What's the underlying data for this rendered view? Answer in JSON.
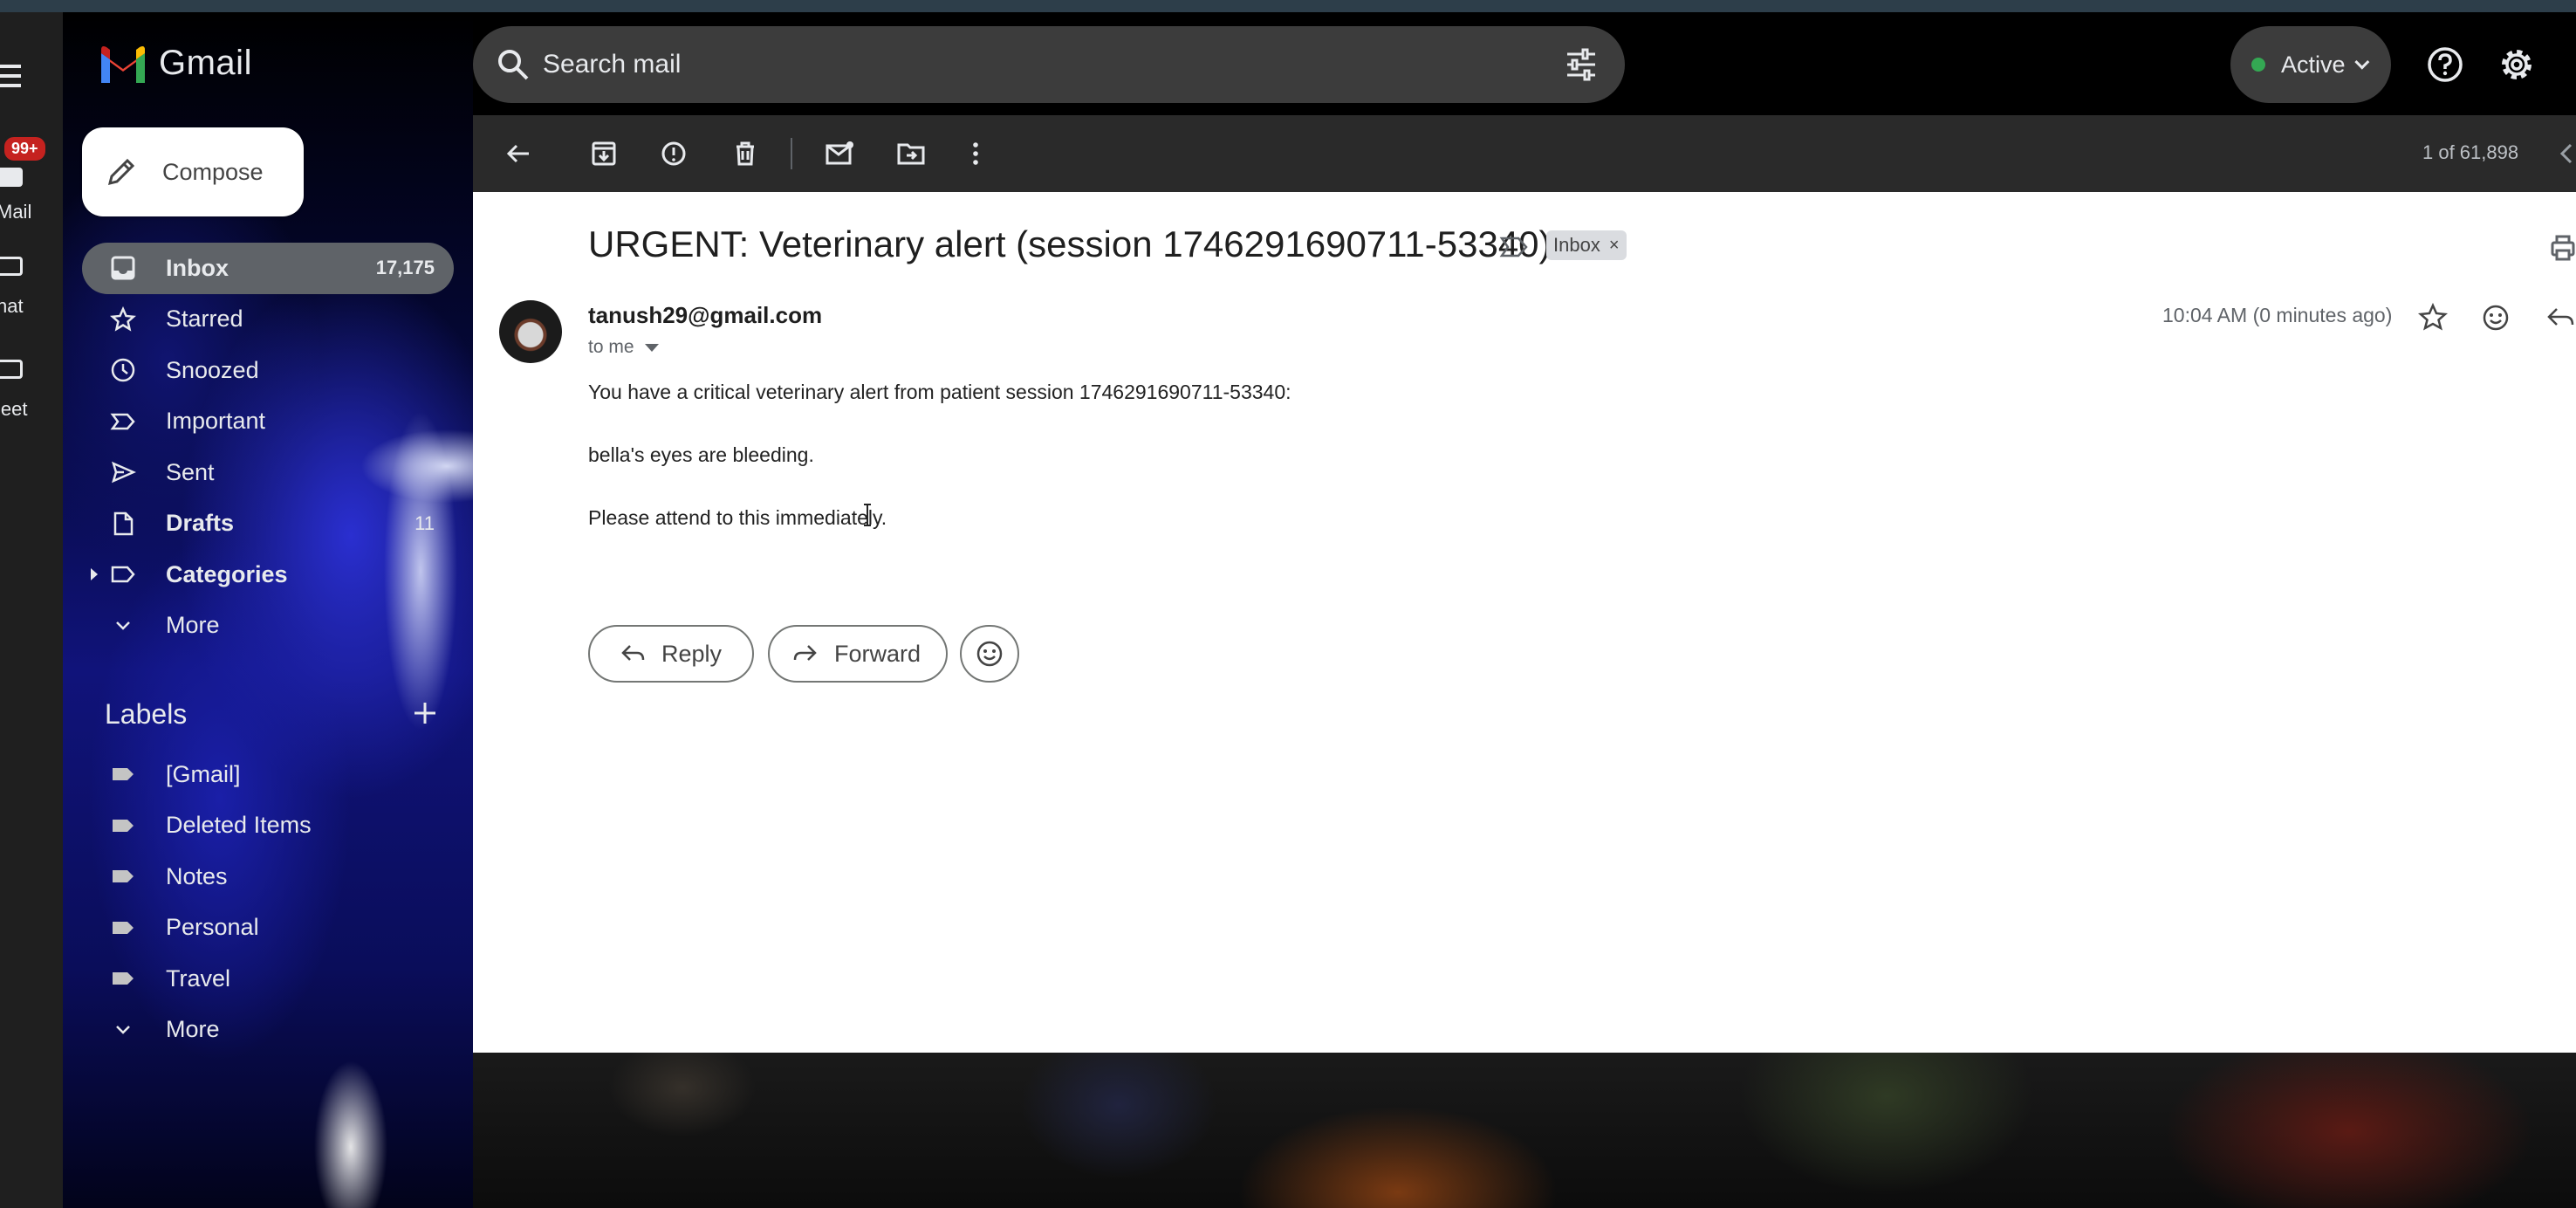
{
  "app": {
    "name": "Gmail"
  },
  "rail": {
    "badge": "99+",
    "items": [
      {
        "label": "Mail"
      },
      {
        "label": "hat"
      },
      {
        "label": "leet"
      }
    ]
  },
  "search": {
    "placeholder": "Search mail"
  },
  "status": {
    "label": "Active",
    "color": "#34a853"
  },
  "compose": {
    "label": "Compose"
  },
  "nav": {
    "items": [
      {
        "label": "Inbox",
        "count": "17,175",
        "icon": "inbox-icon",
        "selected": true
      },
      {
        "label": "Starred",
        "count": "",
        "icon": "star-icon"
      },
      {
        "label": "Snoozed",
        "count": "",
        "icon": "clock-icon"
      },
      {
        "label": "Important",
        "count": "",
        "icon": "important-icon"
      },
      {
        "label": "Sent",
        "count": "",
        "icon": "send-icon"
      },
      {
        "label": "Drafts",
        "count": "11",
        "icon": "draft-icon"
      },
      {
        "label": "Categories",
        "count": "",
        "icon": "label-icon"
      },
      {
        "label": "More",
        "count": "",
        "icon": "chevron-down-icon"
      }
    ]
  },
  "labels": {
    "heading": "Labels",
    "items": [
      {
        "label": "[Gmail]"
      },
      {
        "label": "Deleted Items"
      },
      {
        "label": "Notes"
      },
      {
        "label": "Personal"
      },
      {
        "label": "Travel"
      }
    ],
    "more": "More"
  },
  "toolbar": {
    "pager": "1 of 61,898",
    "icons": [
      "back-icon",
      "archive-icon",
      "report-spam-icon",
      "delete-icon",
      "mark-unread-icon",
      "move-to-icon",
      "more-vert-icon"
    ]
  },
  "message": {
    "subject": "URGENT: Veterinary alert (session 1746291690711-53340)",
    "chip": "Inbox",
    "sender": "tanush29@gmail.com",
    "to": "to me",
    "timestamp": "10:04 AM (0 minutes ago)",
    "body": [
      "You have a critical veterinary alert from patient session 1746291690711-53340:",
      "bella's eyes are bleeding.",
      "Please attend to this immediately."
    ],
    "reply_label": "Reply",
    "forward_label": "Forward"
  }
}
